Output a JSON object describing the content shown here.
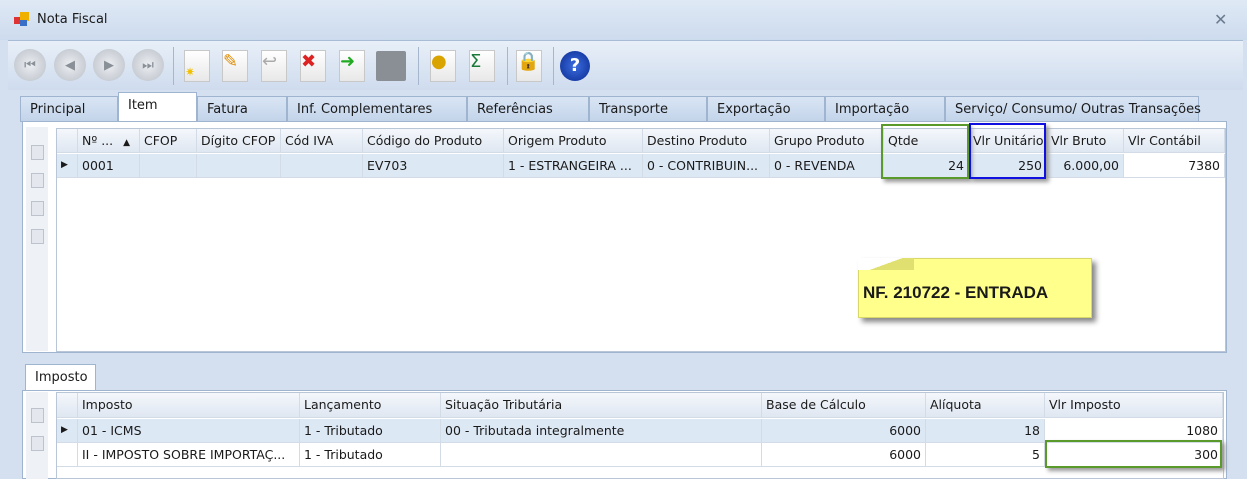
{
  "window": {
    "title": "Nota Fiscal",
    "close": "✕"
  },
  "toolbar": {
    "buttons": [
      "first-record",
      "previous-record",
      "next-record",
      "last-record",
      "new",
      "edit",
      "undo",
      "delete",
      "confirm",
      "save",
      "financial",
      "totals",
      "lock",
      "help"
    ]
  },
  "tabs": [
    "Principal",
    "Item",
    "Fatura",
    "Inf. Complementares",
    "Referências",
    "Transporte",
    "Exportação",
    "Importação",
    "Serviço/ Consumo/ Outras Transações"
  ],
  "active_tab": "Item",
  "items_grid": {
    "columns": [
      "Nº ...",
      "CFOP",
      "Dígito CFOP",
      "Cód IVA",
      "Código do Produto",
      "Origem Produto",
      "Destino Produto",
      "Grupo Produto",
      "Qtde",
      "Vlr Unitário",
      "Vlr Bruto",
      "Vlr Contábil"
    ],
    "rows": [
      [
        "0001",
        "",
        "",
        "",
        "EV703",
        "1 - ESTRANGEIRA ...",
        "0 - CONTRIBUIN...",
        "0 - REVENDA",
        "24",
        "250",
        "6.000,00",
        "7380"
      ]
    ]
  },
  "note": "NF. 210722 - ENTRADA",
  "tax_tab": "Imposto",
  "tax_grid": {
    "columns": [
      "Imposto",
      "Lançamento",
      "Situação Tributária",
      "Base de Cálculo",
      "Alíquota",
      "Vlr Imposto"
    ],
    "rows": [
      [
        "01 - ICMS",
        "1 - Tributado",
        "00 - Tributada integralmente",
        "6000",
        "18",
        "1080"
      ],
      [
        "II - IMPOSTO SOBRE IMPORTAÇ...",
        "1 - Tributado",
        "",
        "6000",
        "5",
        "300"
      ]
    ]
  },
  "colors": {
    "highlight_green": "#5a9a2a",
    "highlight_blue": "#1010e0",
    "note_bg": "#ffff8c"
  }
}
